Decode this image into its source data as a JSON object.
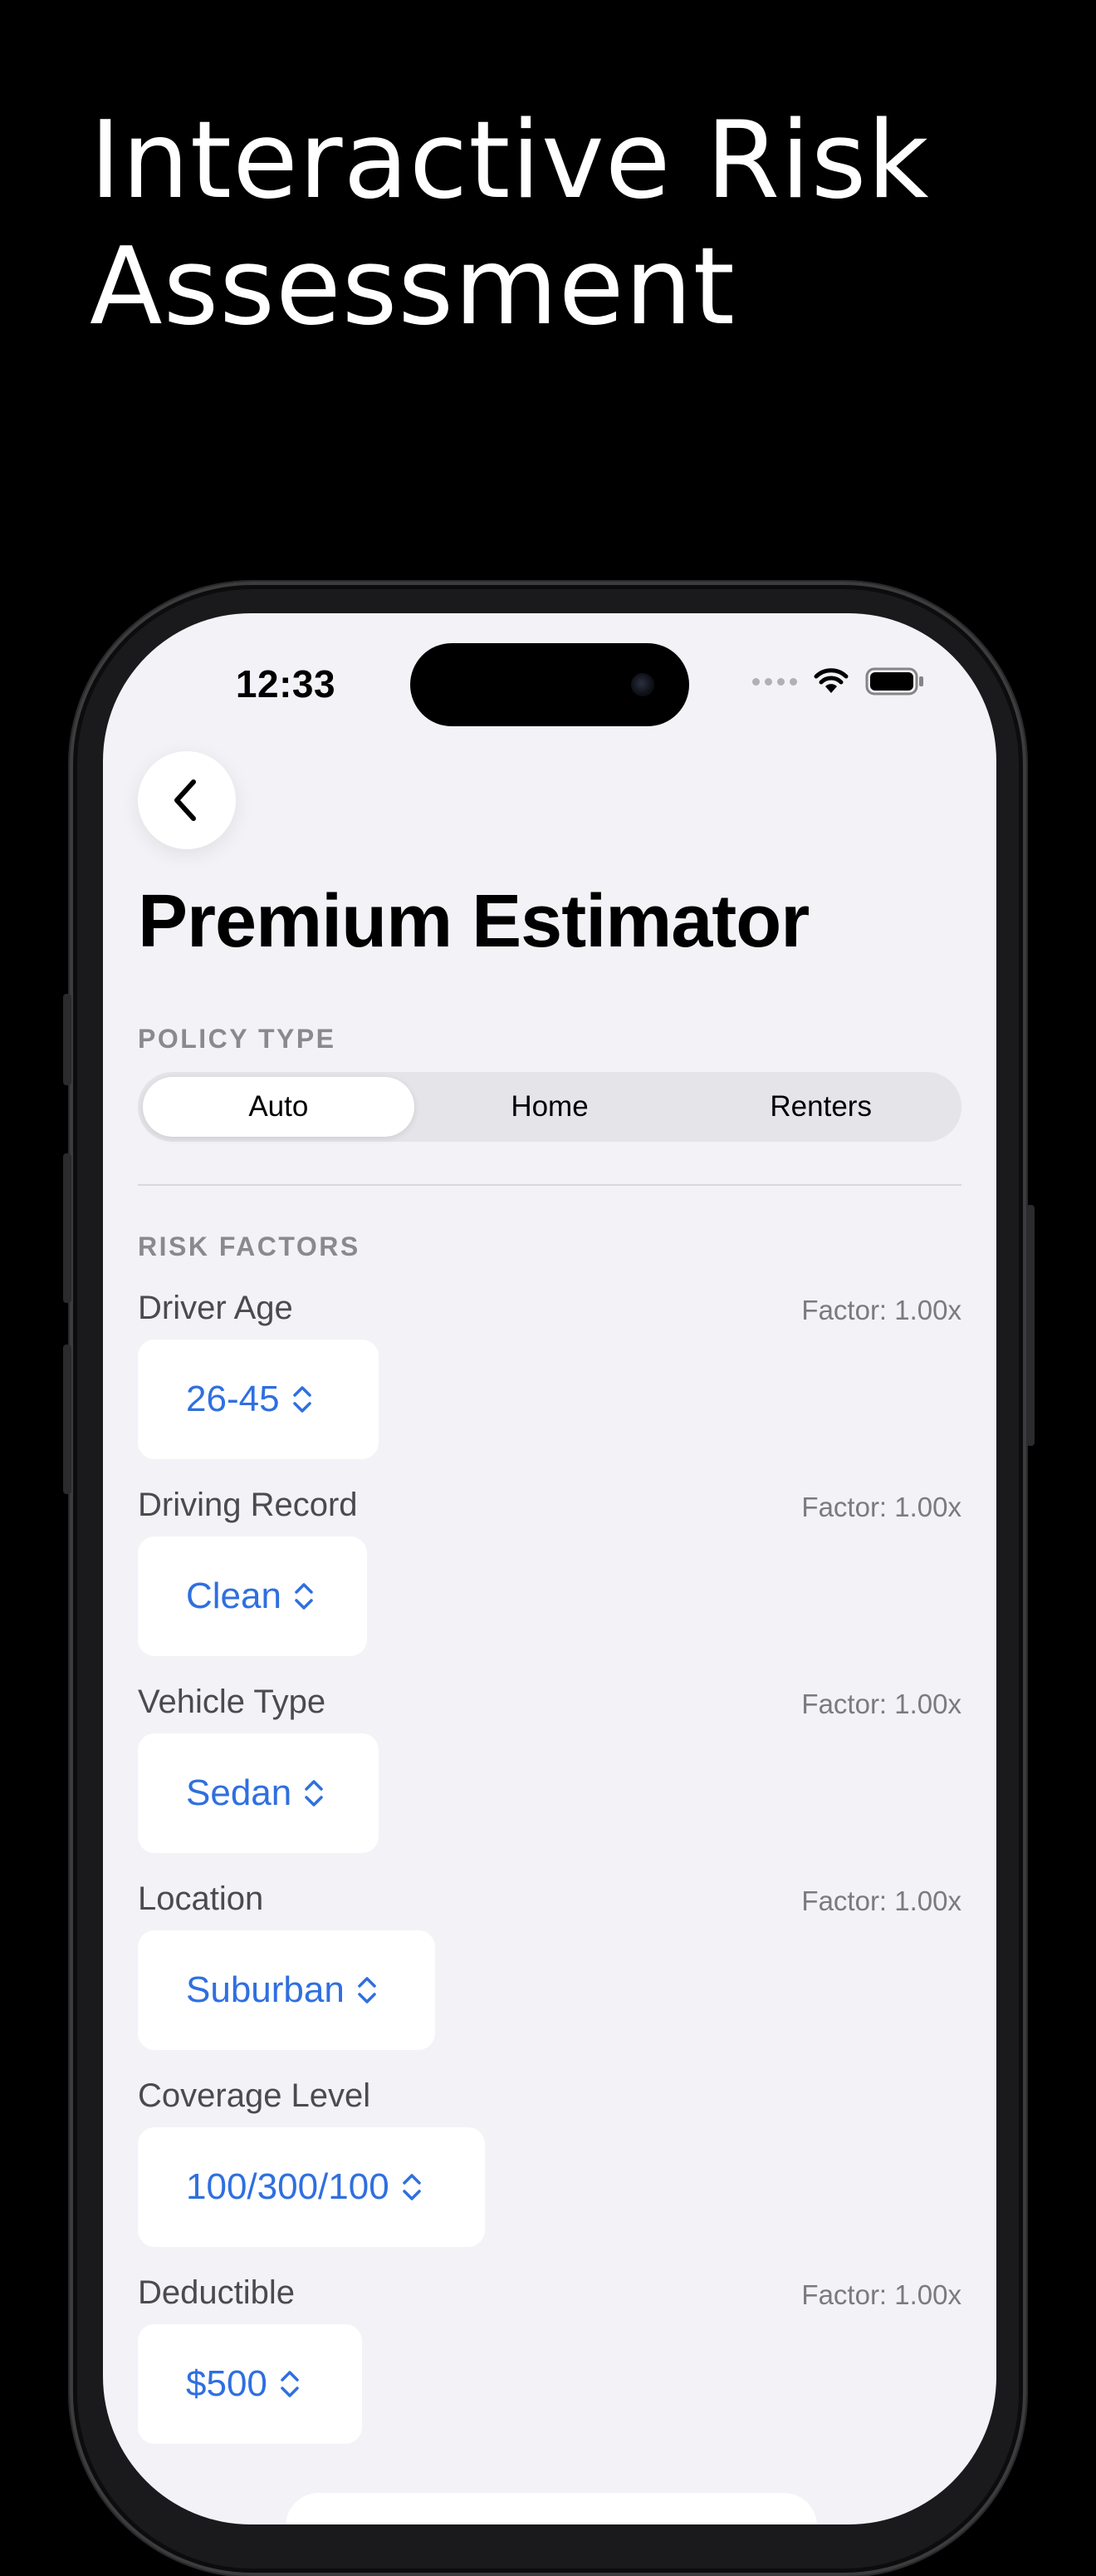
{
  "headline": {
    "line1": "Interactive Risk",
    "line2": "Assessment"
  },
  "status_bar": {
    "time": "12:33"
  },
  "page": {
    "title": "Premium Estimator"
  },
  "policy_type": {
    "label": "POLICY TYPE",
    "options": [
      "Auto",
      "Home",
      "Renters"
    ],
    "selected": "Auto"
  },
  "risk_factors": {
    "label": "RISK FACTORS",
    "items": [
      {
        "name": "Driver Age",
        "value": "26-45",
        "factor": "Factor: 1.00x"
      },
      {
        "name": "Driving Record",
        "value": "Clean",
        "factor": "Factor: 1.00x"
      },
      {
        "name": "Vehicle Type",
        "value": "Sedan",
        "factor": "Factor: 1.00x"
      },
      {
        "name": "Location",
        "value": "Suburban",
        "factor": "Factor: 1.00x"
      },
      {
        "name": "Coverage Level",
        "value": "100/300/100",
        "factor": ""
      },
      {
        "name": "Deductible",
        "value": "$500",
        "factor": "Factor: 1.00x"
      }
    ]
  },
  "colors": {
    "accent": "#2f6fe0",
    "background": "#f2f2f7",
    "backdrop": "#000000"
  },
  "icons": [
    "chevron-left-icon",
    "wifi-icon",
    "battery-icon",
    "cellular-dots-icon",
    "chevron-up-down-icon"
  ]
}
